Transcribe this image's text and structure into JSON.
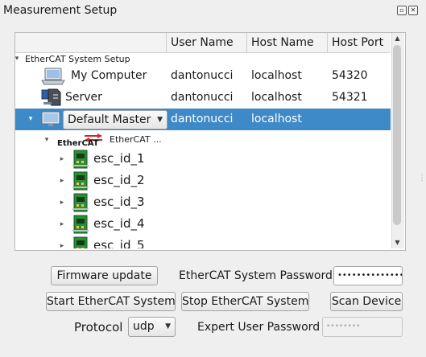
{
  "window": {
    "title": "Measurement Setup"
  },
  "icons": {
    "float": "float-window-icon",
    "close": "close-window-icon",
    "computer": "laptop-computer-icon",
    "server": "server-tower-icon",
    "master": "monitor-icon",
    "ethercat": "ethercat-logo-icon",
    "slave": "green-pcb-board-icon"
  },
  "tree": {
    "columns": [
      "",
      "User Name",
      "Host Name",
      "Host Port"
    ],
    "root_label": "EtherCAT System Setup",
    "computer": {
      "name": "My Computer",
      "user": "dantonucci",
      "host": "localhost",
      "port": "54320"
    },
    "server": {
      "name": "Server",
      "user": "dantonucci",
      "host": "localhost",
      "port": "54321"
    },
    "master": {
      "selected_value": "Default Master",
      "user": "dantonucci",
      "host": "localhost"
    },
    "ethercat_logo_text": "EtherCAT",
    "ethercat_node_label": "EtherCAT ...",
    "slaves": [
      "esc_id_1",
      "esc_id_2",
      "esc_id_3",
      "esc_id_4",
      "esc_id_5"
    ]
  },
  "controls": {
    "firmware_update": "Firmware update",
    "password_label": "EtherCAT System Password",
    "password_value": "•••••••••••••••",
    "start_system": "Start EtherCAT System",
    "stop_system": "Stop EtherCAT System",
    "scan_device": "Scan Device",
    "protocol_label": "Protocol",
    "protocol_value": "udp",
    "expert_label": "Expert User Password",
    "expert_placeholder": "••••••••"
  },
  "colors": {
    "selection": "#3e89c7",
    "board_green": "#2e8b3a"
  }
}
